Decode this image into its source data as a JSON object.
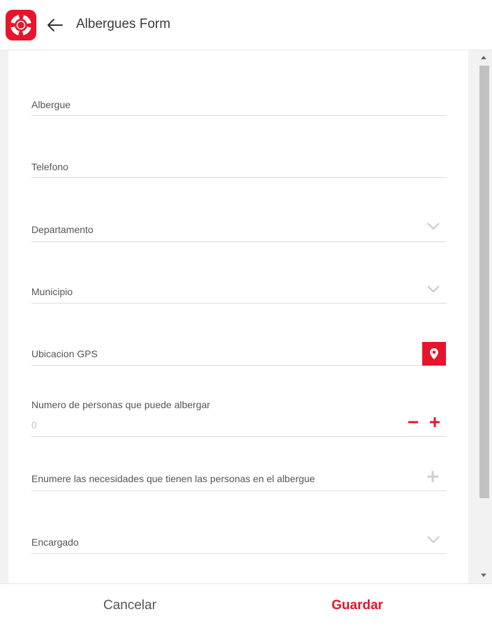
{
  "header": {
    "title": "Albergues Form",
    "logo_icon": "lifebuoy-icon",
    "back_icon": "arrow-left-icon"
  },
  "colors": {
    "accent": "#e8142b",
    "text": "#555555",
    "divider": "#dcdcdc"
  },
  "form": {
    "albergue_label": "Albergue",
    "telefono_label": "Telefono",
    "departamento_label": "Departamento",
    "municipio_label": "Municipio",
    "gps_label": "Ubicacion GPS",
    "gps_icon": "map-pin-icon",
    "personas_label": "Numero de personas que puede albergar",
    "personas_value": "0",
    "necesidades_label": "Enumere las necesidades que tienen las personas en el albergue",
    "encargado_label": "Encargado"
  },
  "footer": {
    "cancel_label": "Cancelar",
    "save_label": "Guardar"
  }
}
